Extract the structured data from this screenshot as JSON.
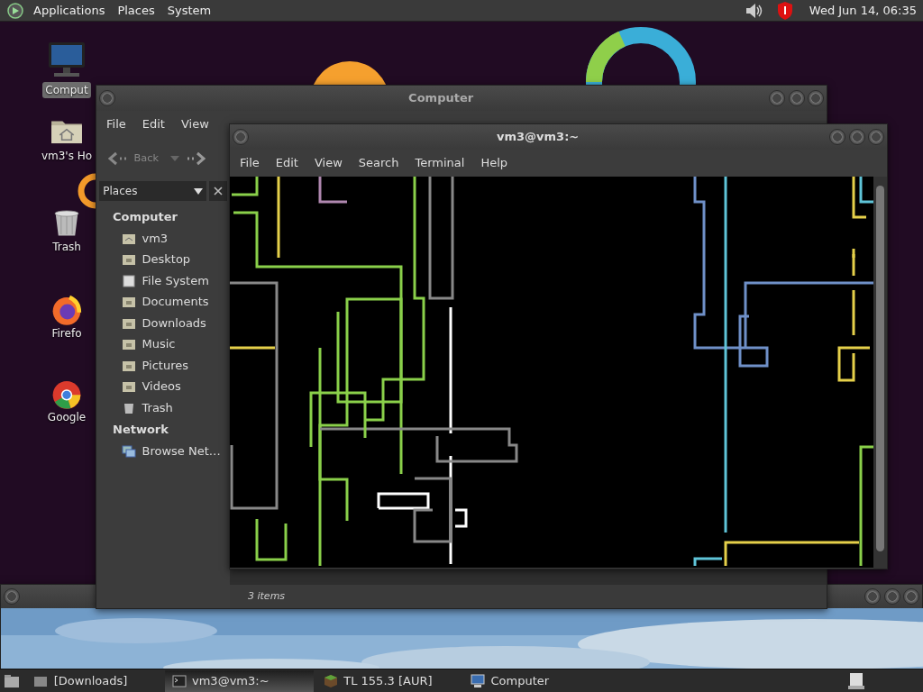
{
  "top_panel": {
    "menus": [
      "Applications",
      "Places",
      "System"
    ],
    "clock": "Wed Jun 14, 06:35"
  },
  "desktop_icons": [
    {
      "kind": "computer",
      "label": "Comput",
      "selected": true
    },
    {
      "kind": "home",
      "label": "vm3's Ho",
      "selected": false
    },
    {
      "kind": "trash",
      "label": "Trash",
      "selected": false
    },
    {
      "kind": "firefox",
      "label": "Firefo",
      "selected": false
    },
    {
      "kind": "chrome",
      "label": "Google",
      "selected": false
    }
  ],
  "file_manager": {
    "title": "Computer",
    "menu": [
      "File",
      "Edit",
      "View"
    ],
    "back": "Back",
    "sidebar_mode": "Places",
    "sections": [
      {
        "heading": "Computer",
        "items": [
          {
            "kind": "home",
            "label": "vm3"
          },
          {
            "kind": "folder",
            "label": "Desktop"
          },
          {
            "kind": "drive",
            "label": "File System"
          },
          {
            "kind": "folder",
            "label": "Documents"
          },
          {
            "kind": "folder",
            "label": "Downloads"
          },
          {
            "kind": "folder",
            "label": "Music"
          },
          {
            "kind": "folder",
            "label": "Pictures"
          },
          {
            "kind": "folder",
            "label": "Videos"
          },
          {
            "kind": "trash",
            "label": "Trash"
          }
        ]
      },
      {
        "heading": "Network",
        "items": [
          {
            "kind": "network",
            "label": "Browse Net…"
          }
        ]
      }
    ],
    "status": "3 items"
  },
  "terminal": {
    "title": "vm3@vm3:~",
    "menu": [
      "File",
      "Edit",
      "View",
      "Search",
      "Terminal",
      "Help"
    ]
  },
  "taskbar": {
    "items": [
      {
        "kind": "folder",
        "label": "[Downloads]",
        "selected": false
      },
      {
        "kind": "terminal",
        "label": "vm3@vm3:~",
        "selected": true
      },
      {
        "kind": "cube",
        "label": "TL 155.3 [AUR]",
        "selected": false
      },
      {
        "kind": "computer",
        "label": "Computer",
        "selected": false
      }
    ]
  }
}
